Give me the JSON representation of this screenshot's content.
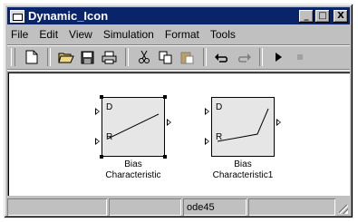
{
  "window": {
    "title": "Dynamic_Icon",
    "controls": {
      "minimize": "_",
      "maximize": "□",
      "close": "X"
    }
  },
  "menu": [
    "File",
    "Edit",
    "View",
    "Simulation",
    "Format",
    "Tools"
  ],
  "toolbar": {
    "buttons": [
      "new-icon",
      "open-icon",
      "save-icon",
      "print-icon",
      "cut-icon",
      "copy-icon",
      "paste-icon",
      "undo-icon",
      "redo-icon",
      "start-icon",
      "stop-icon"
    ]
  },
  "blocks": [
    {
      "port_d": "D",
      "port_r": "R",
      "label_line1": "Bias",
      "label_line2": "Characteristic"
    },
    {
      "port_d": "D",
      "port_r": "R",
      "label_line1": "Bias",
      "label_line2": "Characteristic1"
    }
  ],
  "status": {
    "ready": "",
    "solver": "ode45"
  }
}
